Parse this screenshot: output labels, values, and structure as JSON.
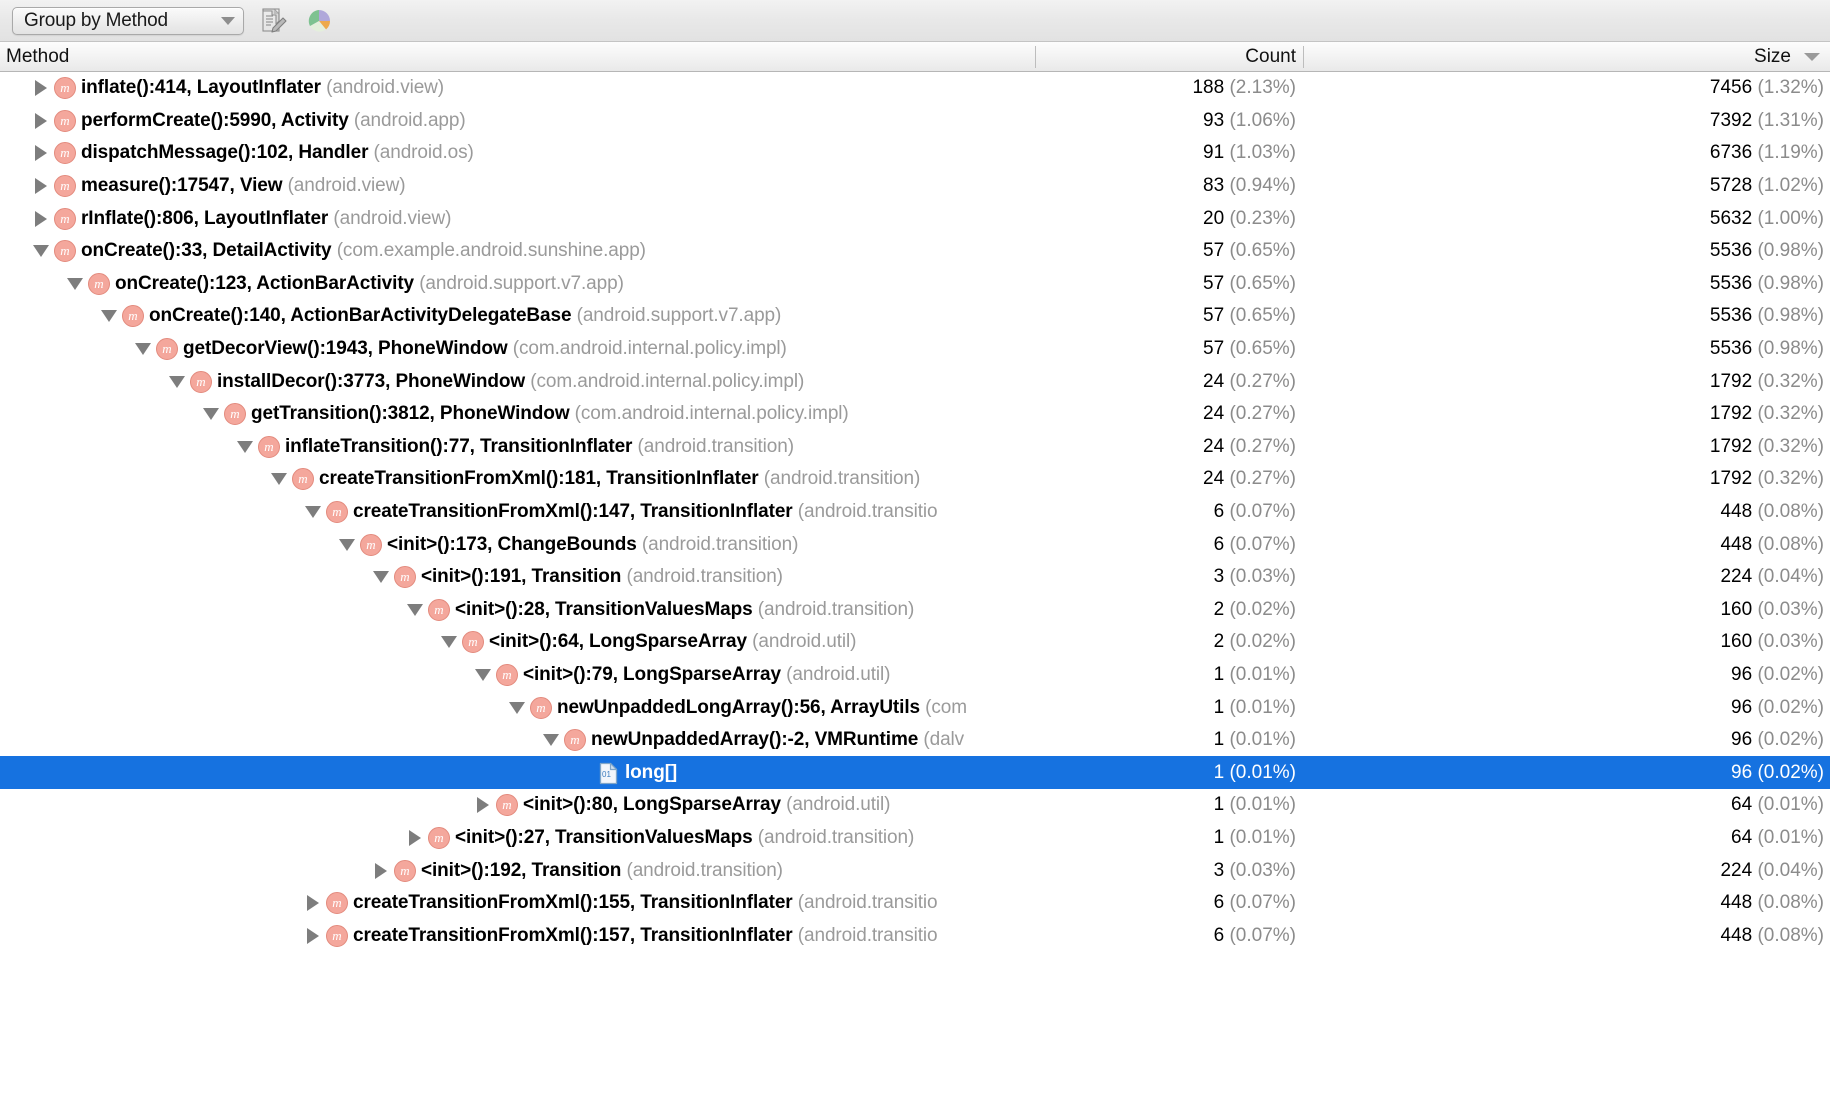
{
  "toolbar": {
    "group_by": {
      "label": "Group by Method",
      "icon": "chevron-down-icon"
    },
    "buttons": [
      {
        "name": "edit-document-button",
        "icon": "document-edit-icon",
        "title": "Edit"
      },
      {
        "name": "pie-chart-button",
        "icon": "pie-chart-icon",
        "title": "Chart"
      }
    ]
  },
  "table": {
    "columns": [
      {
        "key": "method",
        "label": "Method",
        "align": "left",
        "sorted": false
      },
      {
        "key": "count",
        "label": "Count",
        "align": "right",
        "sorted": false
      },
      {
        "key": "size",
        "label": "Size",
        "align": "right",
        "sorted": true,
        "sort_direction": "desc"
      }
    ],
    "rows": [
      {
        "depth": 0,
        "state": "collapsed",
        "icon": "method-icon",
        "method": "inflate():414, LayoutInflater",
        "package": "(android.view)",
        "count": "188",
        "count_pct": "(2.13%)",
        "size": "7456",
        "size_pct": "(1.32%)",
        "selected": false
      },
      {
        "depth": 0,
        "state": "collapsed",
        "icon": "method-icon",
        "method": "performCreate():5990, Activity",
        "package": "(android.app)",
        "count": "93",
        "count_pct": "(1.06%)",
        "size": "7392",
        "size_pct": "(1.31%)",
        "selected": false
      },
      {
        "depth": 0,
        "state": "collapsed",
        "icon": "method-icon",
        "method": "dispatchMessage():102, Handler",
        "package": "(android.os)",
        "count": "91",
        "count_pct": "(1.03%)",
        "size": "6736",
        "size_pct": "(1.19%)",
        "selected": false
      },
      {
        "depth": 0,
        "state": "collapsed",
        "icon": "method-icon",
        "method": "measure():17547, View",
        "package": "(android.view)",
        "count": "83",
        "count_pct": "(0.94%)",
        "size": "5728",
        "size_pct": "(1.02%)",
        "selected": false
      },
      {
        "depth": 0,
        "state": "collapsed",
        "icon": "method-icon",
        "method": "rInflate():806, LayoutInflater",
        "package": "(android.view)",
        "count": "20",
        "count_pct": "(0.23%)",
        "size": "5632",
        "size_pct": "(1.00%)",
        "selected": false
      },
      {
        "depth": 0,
        "state": "expanded",
        "icon": "method-icon",
        "method": "onCreate():33, DetailActivity",
        "package": "(com.example.android.sunshine.app)",
        "count": "57",
        "count_pct": "(0.65%)",
        "size": "5536",
        "size_pct": "(0.98%)",
        "selected": false
      },
      {
        "depth": 1,
        "state": "expanded",
        "icon": "method-icon",
        "method": "onCreate():123, ActionBarActivity",
        "package": "(android.support.v7.app)",
        "count": "57",
        "count_pct": "(0.65%)",
        "size": "5536",
        "size_pct": "(0.98%)",
        "selected": false
      },
      {
        "depth": 2,
        "state": "expanded",
        "icon": "method-icon",
        "method": "onCreate():140, ActionBarActivityDelegateBase",
        "package": "(android.support.v7.app)",
        "count": "57",
        "count_pct": "(0.65%)",
        "size": "5536",
        "size_pct": "(0.98%)",
        "selected": false
      },
      {
        "depth": 3,
        "state": "expanded",
        "icon": "method-icon",
        "method": "getDecorView():1943, PhoneWindow",
        "package": "(com.android.internal.policy.impl)",
        "count": "57",
        "count_pct": "(0.65%)",
        "size": "5536",
        "size_pct": "(0.98%)",
        "selected": false
      },
      {
        "depth": 4,
        "state": "expanded",
        "icon": "method-icon",
        "method": "installDecor():3773, PhoneWindow",
        "package": "(com.android.internal.policy.impl)",
        "count": "24",
        "count_pct": "(0.27%)",
        "size": "1792",
        "size_pct": "(0.32%)",
        "selected": false
      },
      {
        "depth": 5,
        "state": "expanded",
        "icon": "method-icon",
        "method": "getTransition():3812, PhoneWindow",
        "package": "(com.android.internal.policy.impl)",
        "count": "24",
        "count_pct": "(0.27%)",
        "size": "1792",
        "size_pct": "(0.32%)",
        "selected": false
      },
      {
        "depth": 6,
        "state": "expanded",
        "icon": "method-icon",
        "method": "inflateTransition():77, TransitionInflater",
        "package": "(android.transition)",
        "count": "24",
        "count_pct": "(0.27%)",
        "size": "1792",
        "size_pct": "(0.32%)",
        "selected": false
      },
      {
        "depth": 7,
        "state": "expanded",
        "icon": "method-icon",
        "method": "createTransitionFromXml():181, TransitionInflater",
        "package": "(android.transition)",
        "count": "24",
        "count_pct": "(0.27%)",
        "size": "1792",
        "size_pct": "(0.32%)",
        "selected": false
      },
      {
        "depth": 8,
        "state": "expanded",
        "icon": "method-icon",
        "method": "createTransitionFromXml():147, TransitionInflater",
        "package": "(android.transitio",
        "count": "6",
        "count_pct": "(0.07%)",
        "size": "448",
        "size_pct": "(0.08%)",
        "selected": false
      },
      {
        "depth": 9,
        "state": "expanded",
        "icon": "method-icon",
        "method": "<init>():173, ChangeBounds",
        "package": "(android.transition)",
        "count": "6",
        "count_pct": "(0.07%)",
        "size": "448",
        "size_pct": "(0.08%)",
        "selected": false
      },
      {
        "depth": 10,
        "state": "expanded",
        "icon": "method-icon",
        "method": "<init>():191, Transition",
        "package": "(android.transition)",
        "count": "3",
        "count_pct": "(0.03%)",
        "size": "224",
        "size_pct": "(0.04%)",
        "selected": false
      },
      {
        "depth": 11,
        "state": "expanded",
        "icon": "method-icon",
        "method": "<init>():28, TransitionValuesMaps",
        "package": "(android.transition)",
        "count": "2",
        "count_pct": "(0.02%)",
        "size": "160",
        "size_pct": "(0.03%)",
        "selected": false
      },
      {
        "depth": 12,
        "state": "expanded",
        "icon": "method-icon",
        "method": "<init>():64, LongSparseArray",
        "package": "(android.util)",
        "count": "2",
        "count_pct": "(0.02%)",
        "size": "160",
        "size_pct": "(0.03%)",
        "selected": false
      },
      {
        "depth": 13,
        "state": "expanded",
        "icon": "method-icon",
        "method": "<init>():79, LongSparseArray",
        "package": "(android.util)",
        "count": "1",
        "count_pct": "(0.01%)",
        "size": "96",
        "size_pct": "(0.02%)",
        "selected": false
      },
      {
        "depth": 14,
        "state": "expanded",
        "icon": "method-icon",
        "method": "newUnpaddedLongArray():56, ArrayUtils",
        "package": "(com",
        "count": "1",
        "count_pct": "(0.01%)",
        "size": "96",
        "size_pct": "(0.02%)",
        "selected": false
      },
      {
        "depth": 15,
        "state": "expanded",
        "icon": "method-icon",
        "method": "newUnpaddedArray():-2, VMRuntime",
        "package": "(dalv",
        "count": "1",
        "count_pct": "(0.01%)",
        "size": "96",
        "size_pct": "(0.02%)",
        "selected": false
      },
      {
        "depth": 16,
        "state": "leaf",
        "icon": "binary-file-icon",
        "method": "long[]",
        "package": "",
        "count": "1",
        "count_pct": "(0.01%)",
        "size": "96",
        "size_pct": "(0.02%)",
        "selected": true
      },
      {
        "depth": 13,
        "state": "collapsed",
        "icon": "method-icon",
        "method": "<init>():80, LongSparseArray",
        "package": "(android.util)",
        "count": "1",
        "count_pct": "(0.01%)",
        "size": "64",
        "size_pct": "(0.01%)",
        "selected": false
      },
      {
        "depth": 11,
        "state": "collapsed",
        "icon": "method-icon",
        "method": "<init>():27, TransitionValuesMaps",
        "package": "(android.transition)",
        "count": "1",
        "count_pct": "(0.01%)",
        "size": "64",
        "size_pct": "(0.01%)",
        "selected": false
      },
      {
        "depth": 10,
        "state": "collapsed",
        "icon": "method-icon",
        "method": "<init>():192, Transition",
        "package": "(android.transition)",
        "count": "3",
        "count_pct": "(0.03%)",
        "size": "224",
        "size_pct": "(0.04%)",
        "selected": false
      },
      {
        "depth": 8,
        "state": "collapsed",
        "icon": "method-icon",
        "method": "createTransitionFromXml():155, TransitionInflater",
        "package": "(android.transitio",
        "count": "6",
        "count_pct": "(0.07%)",
        "size": "448",
        "size_pct": "(0.08%)",
        "selected": false
      },
      {
        "depth": 8,
        "state": "collapsed",
        "icon": "method-icon",
        "method": "createTransitionFromXml():157, TransitionInflater",
        "package": "(android.transitio",
        "count": "6",
        "count_pct": "(0.07%)",
        "size": "448",
        "size_pct": "(0.08%)",
        "selected": false
      }
    ]
  },
  "colors": {
    "selection": "#1672e0",
    "method_icon": "#f4a79c",
    "package_text": "#9a9a9a",
    "header_text": "#111111"
  }
}
